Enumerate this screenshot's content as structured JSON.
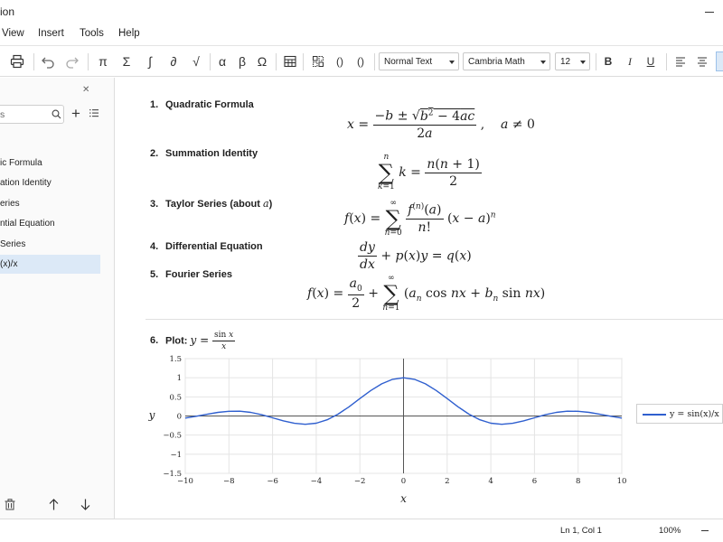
{
  "window": {
    "title": "ion"
  },
  "menu": [
    "View",
    "Insert",
    "Tools",
    "Help"
  ],
  "toolbar": {
    "symbols": [
      "π",
      "Σ",
      "∫",
      "∂",
      "√",
      "α",
      "β",
      "Ω"
    ],
    "brackets": [
      "()",
      "()"
    ],
    "style_select": "Normal Text",
    "font_select": "Cambria Math",
    "size_select": "12",
    "format": [
      "B",
      "I",
      "U"
    ]
  },
  "sidebar": {
    "search_placeholder": "s",
    "items": [
      {
        "label": "ic Formula"
      },
      {
        "label": "ation Identity"
      },
      {
        "label": "eries"
      },
      {
        "label": "ntial Equation"
      },
      {
        "label": "Series"
      },
      {
        "label": "(x)/x",
        "selected": true
      }
    ]
  },
  "equations": [
    {
      "num": "1.",
      "title": "Quadratic Formula"
    },
    {
      "num": "2.",
      "title": "Summation Identity"
    },
    {
      "num": "3.",
      "title": "Taylor Series (about ",
      "title_var": "a",
      "title_end": ")"
    },
    {
      "num": "4.",
      "title": "Differential Equation"
    },
    {
      "num": "5.",
      "title": "Fourier Series"
    },
    {
      "num": "6.",
      "title": "Plot:"
    }
  ],
  "chart_data": {
    "type": "line",
    "title": "",
    "xlabel": "x",
    "ylabel": "y",
    "xlim": [
      -10,
      10
    ],
    "ylim": [
      -1.5,
      1.5
    ],
    "x_ticks": [
      -10,
      -8,
      -6,
      -4,
      -2,
      0,
      2,
      4,
      6,
      8,
      10
    ],
    "x_tick_labels": [
      "−10",
      "−8",
      "−6",
      "−4",
      "−2",
      "0",
      "2",
      "4",
      "6",
      "8",
      "10"
    ],
    "y_ticks": [
      1.5,
      1,
      0.5,
      0,
      -0.5,
      -1,
      -1.5
    ],
    "y_tick_labels": [
      "1.5",
      "1",
      "0.5",
      "0",
      "−0.5",
      "−1",
      "−1.5"
    ],
    "grid": true,
    "legend": "right",
    "series": [
      {
        "name": "y = sin(x)/x",
        "color": "#2f5fcf",
        "x": [
          -10,
          -9.5,
          -9,
          -8.5,
          -8,
          -7.5,
          -7,
          -6.5,
          -6,
          -5.5,
          -5,
          -4.5,
          -4,
          -3.5,
          -3,
          -2.5,
          -2,
          -1.5,
          -1,
          -0.5,
          0,
          0.5,
          1,
          1.5,
          2,
          2.5,
          3,
          3.5,
          4,
          4.5,
          5,
          5.5,
          6,
          6.5,
          7,
          7.5,
          8,
          8.5,
          9,
          9.5,
          10
        ],
        "y": [
          -0.054,
          -0.008,
          0.046,
          0.094,
          0.124,
          0.125,
          0.094,
          0.033,
          -0.047,
          -0.128,
          -0.192,
          -0.217,
          -0.189,
          -0.1,
          0.047,
          0.239,
          0.455,
          0.665,
          0.841,
          0.959,
          1.0,
          0.959,
          0.841,
          0.665,
          0.455,
          0.239,
          0.047,
          -0.1,
          -0.189,
          -0.217,
          -0.192,
          -0.128,
          -0.047,
          0.033,
          0.094,
          0.125,
          0.124,
          0.094,
          0.046,
          -0.008,
          -0.054
        ]
      }
    ]
  },
  "status": {
    "position": "Ln 1, Col 1",
    "zoom": "100%"
  }
}
